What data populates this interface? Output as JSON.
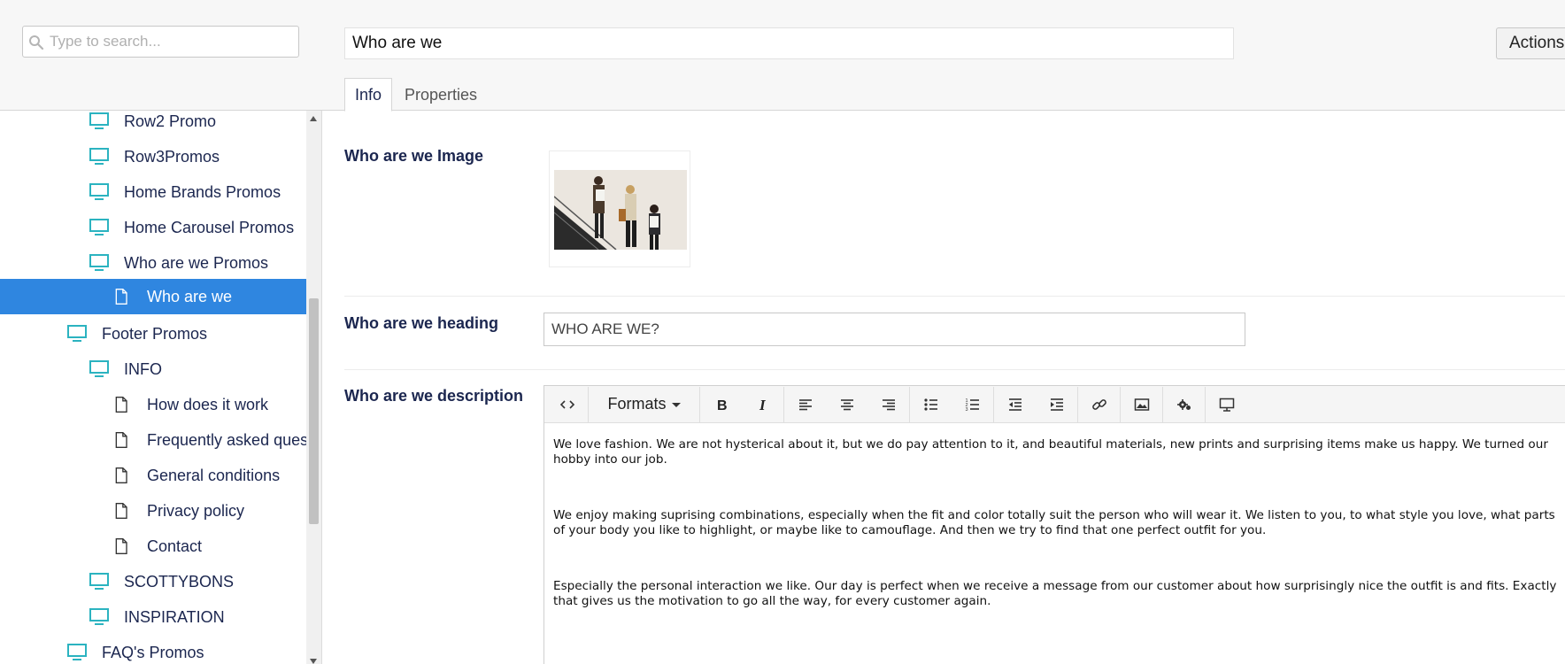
{
  "search": {
    "placeholder": "Type to search..."
  },
  "tree": {
    "items": [
      {
        "label": "Row2 Promo",
        "icon": "monitor-icon"
      },
      {
        "label": "Row3Promos",
        "icon": "monitor-icon"
      },
      {
        "label": "Home Brands Promos",
        "icon": "monitor-icon"
      },
      {
        "label": "Home Carousel Promos",
        "icon": "monitor-icon"
      },
      {
        "label": "Who are we Promos",
        "icon": "monitor-icon"
      },
      {
        "label": "Who are we",
        "icon": "document-icon",
        "selected": true
      },
      {
        "label": "Footer Promos",
        "icon": "monitor-icon"
      },
      {
        "label": "INFO",
        "icon": "monitor-icon"
      },
      {
        "label": "How does it work",
        "icon": "document-icon"
      },
      {
        "label": "Frequently asked ques",
        "icon": "document-icon"
      },
      {
        "label": "General conditions",
        "icon": "document-icon"
      },
      {
        "label": "Privacy policy",
        "icon": "document-icon"
      },
      {
        "label": "Contact",
        "icon": "document-icon"
      },
      {
        "label": "SCOTTYBONS",
        "icon": "monitor-icon"
      },
      {
        "label": "INSPIRATION",
        "icon": "monitor-icon"
      },
      {
        "label": "FAQ's Promos",
        "icon": "monitor-icon"
      }
    ]
  },
  "header": {
    "title_value": "Who are we",
    "actions_label": "Actions"
  },
  "tabs": [
    {
      "label": "Info",
      "active": true
    },
    {
      "label": "Properties",
      "active": false
    }
  ],
  "fields": {
    "image_label": "Who are we Image",
    "heading_label": "Who are we heading",
    "heading_value": "WHO ARE WE?",
    "description_label": "Who are we description"
  },
  "editor": {
    "formats_label": "Formats",
    "toolbar_icons": [
      "source-code-icon",
      "formats-dropdown",
      "bold-icon",
      "italic-icon",
      "align-left-icon",
      "align-center-icon",
      "align-right-icon",
      "bullet-list-icon",
      "numbered-list-icon",
      "outdent-icon",
      "indent-icon",
      "link-icon",
      "image-icon",
      "macro-icon",
      "embed-icon"
    ],
    "paragraphs": [
      "We love fashion. We are not hysterical about it, but we do pay attention to it, and beautiful materials, new prints and surprising items make us happy. We turned our hobby into our job.",
      "We enjoy making suprising combinations, especially when the fit and color totally suit the person who will wear it. We listen to you, to what style you love, what parts of your body you like to highlight, or maybe like to camouflage. And then we try to find that one perfect outfit for you.",
      "Especially the personal interaction we like. Our day is perfect when we receive a message from our customer about how surprisingly nice the outfit is and fits. Exactly that gives us the motivation to go all the way, for every customer again."
    ]
  },
  "colors": {
    "accent": "#2f86e0",
    "tree_icon": "#2bb3c0",
    "text": "#1b264f"
  }
}
